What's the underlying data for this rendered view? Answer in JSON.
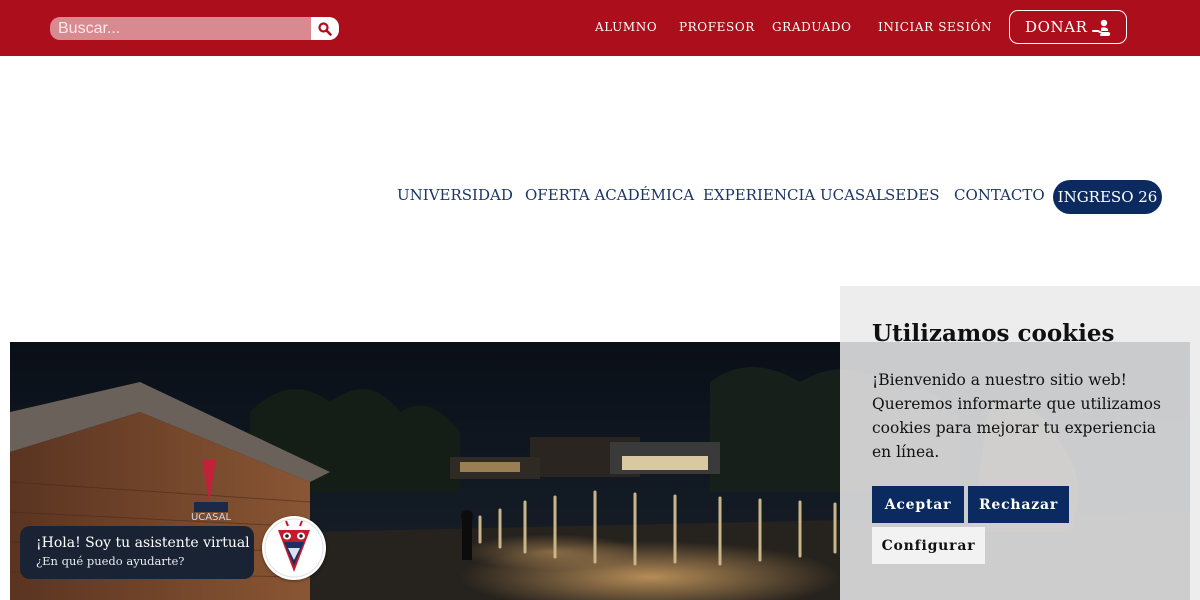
{
  "topbar": {
    "search": {
      "placeholder": "Buscar..."
    },
    "links": [
      "ALUMNO",
      "PROFESOR",
      "GRADUADO",
      "INICIAR SESIÓN"
    ],
    "donate_label": "DONAR"
  },
  "nav": {
    "items": [
      "UNIVERSIDAD",
      "OFERTA ACADÉMICA",
      "EXPERIENCIA UCASAL",
      "SEDES",
      "CONTACTO"
    ],
    "cta": "INGRESO 26"
  },
  "hero": {
    "sign_text": "UCASAL"
  },
  "cookies": {
    "title": "Utilizamos cookies",
    "text": "¡Bienvenido a nuestro sitio web! Queremos informarte que utilizamos cookies para mejorar tu experiencia en línea.",
    "accept": "Aceptar",
    "reject": "Rechazar",
    "configure": "Configurar"
  },
  "chat": {
    "line1": "¡Hola! Soy tu asistente virtual",
    "line2": "¿En qué puedo ayudarte?"
  },
  "colors": {
    "topbar": "#ad0e1c",
    "navy": "#0b2b60",
    "nav_text": "#1b3566"
  }
}
